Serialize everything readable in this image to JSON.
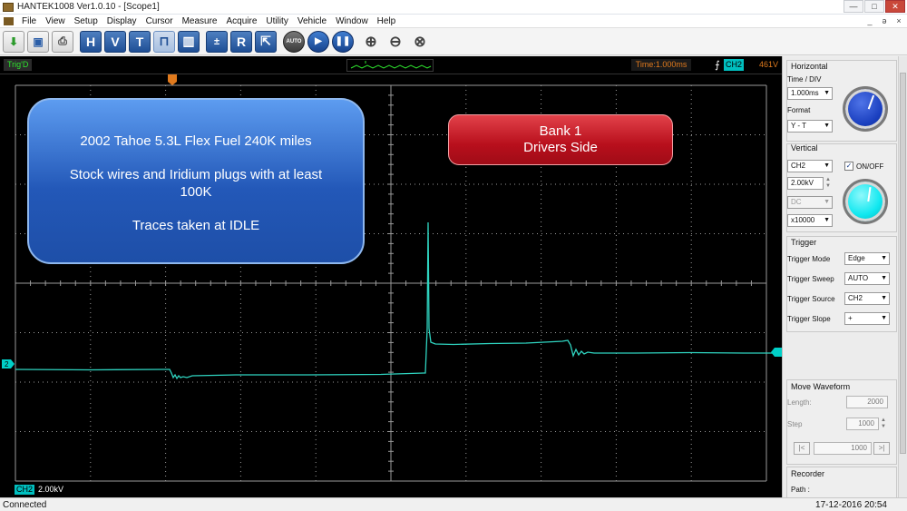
{
  "window": {
    "title": "HANTEK1008 Ver1.0.10 - [Scope1]",
    "buttons": [
      "—",
      "□",
      "✕"
    ]
  },
  "menu": {
    "items": [
      "File",
      "View",
      "Setup",
      "Display",
      "Cursor",
      "Measure",
      "Acquire",
      "Utility",
      "Vehicle",
      "Window",
      "Help"
    ],
    "mdi_buttons": [
      "_",
      "ə",
      "×"
    ]
  },
  "toolbar": {
    "h_label": "H",
    "v_label": "V",
    "t_label": "T",
    "r_label": "R",
    "auto_label": "AUTO"
  },
  "scope": {
    "trig_status": "Trig'D",
    "time_readout": "Time:1.000ms",
    "trigger_channel": "CH2",
    "trigger_voltage": "461V",
    "ch_marker": "2",
    "bottom_channel": "CH2",
    "bottom_scale": "2.00kV",
    "info_box": {
      "line1": "2002 Tahoe 5.3L Flex Fuel 240K miles",
      "line2": "Stock wires and Iridium plugs with at least",
      "line3": "100K",
      "line4": "Traces taken at IDLE"
    },
    "bank_box": {
      "line1": "Bank 1",
      "line2": "Drivers Side"
    },
    "trace_color": "#2fd4c0",
    "grid_color": "#9a9a9a"
  },
  "panel": {
    "horizontal": {
      "title": "Horizontal",
      "time_div_label": "Time / DIV",
      "time_div_value": "1.000ms",
      "format_label": "Format",
      "format_value": "Y - T",
      "knob_color": "#1a3fbf"
    },
    "vertical": {
      "title": "Vertical",
      "channel_value": "CH2",
      "onoff_label": "ON/OFF",
      "onoff_checked": true,
      "volts_value": "2.00kV",
      "coupling_value": "DC",
      "probe_value": "x10000",
      "knob_color": "#10e8f0"
    },
    "trigger": {
      "title": "Trigger",
      "mode_label": "Trigger Mode",
      "mode_value": "Edge",
      "sweep_label": "Trigger Sweep",
      "sweep_value": "AUTO",
      "source_label": "Trigger Source",
      "source_value": "CH2",
      "slope_label": "Trigger Slope",
      "slope_value": "+"
    },
    "move_waveform": {
      "title": "Move Waveform",
      "length_label": "Length:",
      "length_value": "2000",
      "step_label": "Step",
      "step_value": "1000",
      "position_value": "1000",
      "first_btn": "|<",
      "last_btn": ">|"
    },
    "recorder": {
      "title": "Recorder",
      "path_label": "Path :"
    }
  },
  "statusbar": {
    "connection": "Connected",
    "datetime": "17-12-2016  20:54"
  }
}
